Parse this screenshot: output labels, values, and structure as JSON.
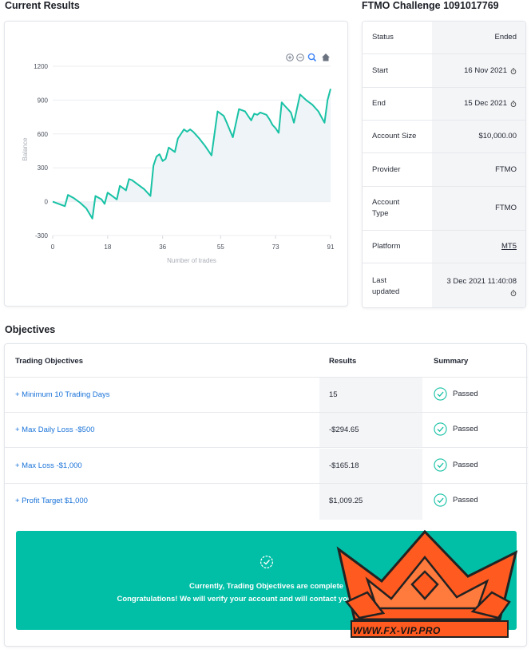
{
  "headings": {
    "current_results": "Current Results",
    "challenge": "FTMO Challenge 1091017769",
    "objectives": "Objectives"
  },
  "chart_data": {
    "type": "area",
    "ylabel": "Balance",
    "xlabel": "Number of trades",
    "ylim": [
      -300,
      1200
    ],
    "xlim": [
      0,
      91
    ],
    "yticks": [
      "1200",
      "900",
      "600",
      "300",
      "0",
      "-300"
    ],
    "ytick_values": [
      1200,
      900,
      600,
      300,
      0,
      -300
    ],
    "xticks": [
      "0",
      "18",
      "36",
      "55",
      "73",
      "91"
    ],
    "xtick_values": [
      0,
      18,
      36,
      55,
      73,
      91
    ],
    "grid": true,
    "line_color": "#18c2a5",
    "fill_color": "#eef4f7",
    "series": [
      {
        "x": [
          0,
          2,
          4,
          5,
          7,
          9,
          11,
          13,
          14,
          16,
          17,
          18,
          19,
          21,
          22,
          23,
          24,
          25,
          26,
          28,
          30,
          32,
          33,
          34,
          35,
          36,
          37,
          38,
          40,
          41,
          43,
          44,
          45,
          46,
          47,
          48,
          50,
          52,
          54,
          56,
          57,
          59,
          61,
          63,
          64,
          65,
          66,
          67,
          68,
          70,
          71,
          72,
          73,
          74,
          75,
          76,
          77,
          78,
          79,
          81,
          83,
          85,
          87,
          89,
          90,
          91
        ],
        "y": [
          0,
          -20,
          -40,
          60,
          30,
          -10,
          -60,
          -150,
          50,
          20,
          -20,
          80,
          60,
          20,
          140,
          120,
          100,
          200,
          190,
          150,
          110,
          50,
          320,
          400,
          420,
          360,
          380,
          480,
          440,
          560,
          640,
          620,
          640,
          620,
          590,
          560,
          490,
          410,
          800,
          760,
          700,
          570,
          820,
          800,
          760,
          720,
          780,
          770,
          790,
          770,
          730,
          680,
          650,
          610,
          880,
          850,
          820,
          790,
          700,
          950,
          900,
          860,
          800,
          700,
          900,
          1000
        ]
      }
    ]
  },
  "chart_tools": [
    "zoom-in-icon",
    "zoom-out-icon",
    "magnify-icon",
    "home-icon"
  ],
  "info": {
    "status_label": "Status",
    "status_value": "Ended",
    "start_label": "Start",
    "start_value": "16 Nov 2021",
    "end_label": "End",
    "end_value": "15 Dec 2021",
    "size_label": "Account Size",
    "size_value": "$10,000.00",
    "provider_label": "Provider",
    "provider_value": "FTMO",
    "type_label_1": "Account",
    "type_label_2": "Type",
    "type_value": "FTMO",
    "platform_label": "Platform",
    "platform_value": "MT5",
    "updated_label_1": "Last",
    "updated_label_2": "updated",
    "updated_value": "3 Dec 2021 11:40:08"
  },
  "objectives": {
    "col_objectives": "Trading Objectives",
    "col_results": "Results",
    "col_summary": "Summary",
    "rows": [
      {
        "name": "+ Minimum 10 Trading Days",
        "result": "15",
        "summary": "Passed"
      },
      {
        "name": "+ Max Daily Loss -$500",
        "result": "-$294.65",
        "summary": "Passed"
      },
      {
        "name": "+ Max Loss -$1,000",
        "result": "-$165.18",
        "summary": "Passed"
      },
      {
        "name": "+ Profit Target $1,000",
        "result": "$1,009.25",
        "summary": "Passed"
      }
    ],
    "banner_line1": "Currently, Trading Objectives are complete",
    "banner_line2": "Congratulations! We will verify your account and will contact you soon as possible"
  },
  "colors": {
    "accent_teal": "#00bfa6",
    "link_blue": "#1a73d9",
    "watermark_orange": "#ff5a1f"
  },
  "watermark": {
    "text": "WWW.FX-VIP.PRO"
  }
}
